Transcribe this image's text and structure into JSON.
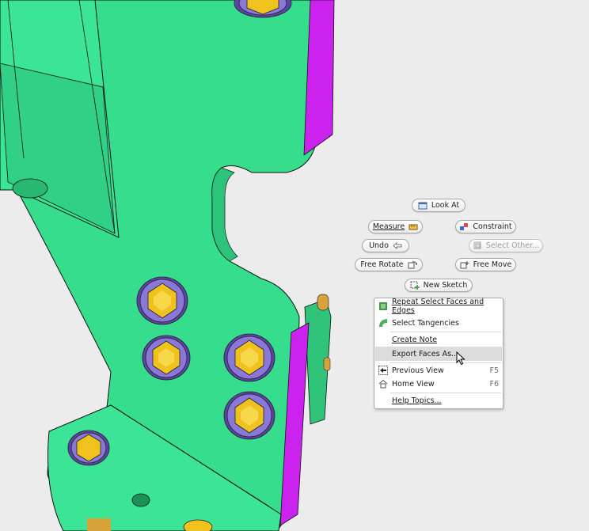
{
  "marking_menu": {
    "look_at": "Look At",
    "measure": "Measure",
    "constraint": "Constraint",
    "undo": "Undo",
    "select_other": "Select Other...",
    "free_rotate": "Free Rotate",
    "free_move": "Free Move",
    "new_sketch": "New Sketch"
  },
  "context_menu": {
    "items": [
      {
        "label": "Repeat Select Faces and Edges",
        "shortcut": "",
        "icon": "repeat-select-icon"
      },
      {
        "label": "Select Tangencies",
        "shortcut": "",
        "icon": "tangency-icon"
      },
      {
        "label": "Create Note",
        "shortcut": "",
        "icon": ""
      },
      {
        "label": "Export Faces As...",
        "shortcut": "",
        "icon": "",
        "highlighted": true
      },
      {
        "label": "Previous View",
        "shortcut": "F5",
        "icon": "previous-view-icon"
      },
      {
        "label": "Home View",
        "shortcut": "F6",
        "icon": "home-icon"
      },
      {
        "label": "Help Topics...",
        "shortcut": "",
        "icon": ""
      }
    ]
  },
  "colors": {
    "background": "#ececec",
    "part_green": "#33dd88",
    "edge_magenta": "#cc22ee",
    "bolt_gold": "#e8b81a",
    "washer_purple": "#6a4fb0"
  }
}
